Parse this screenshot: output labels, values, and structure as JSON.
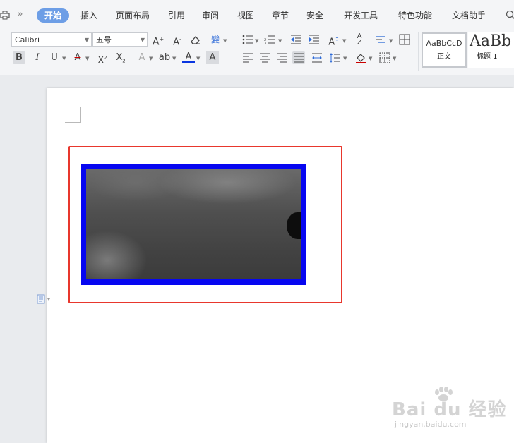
{
  "tabs": {
    "home": "开始",
    "insert": "插入",
    "layout": "页面布局",
    "references": "引用",
    "review": "审阅",
    "view": "视图",
    "chapter": "章节",
    "security": "安全",
    "developer": "开发工具",
    "features": "特色功能",
    "doc_assistant": "文档助手",
    "more": "»"
  },
  "font": {
    "family_value": "Calibri",
    "size_value": "五号"
  },
  "styles": {
    "normal_sample": "AaBbCcD",
    "normal_name": "正文",
    "heading1_sample": "AaBb",
    "heading1_name": "标题 1"
  },
  "watermark": {
    "brand": "Bai du 经验",
    "url": "jingyan.baidu.com"
  },
  "colors": {
    "active_tab": "#6d9ee6",
    "red_frame": "#e8372d",
    "blue_frame": "#0606f0"
  }
}
